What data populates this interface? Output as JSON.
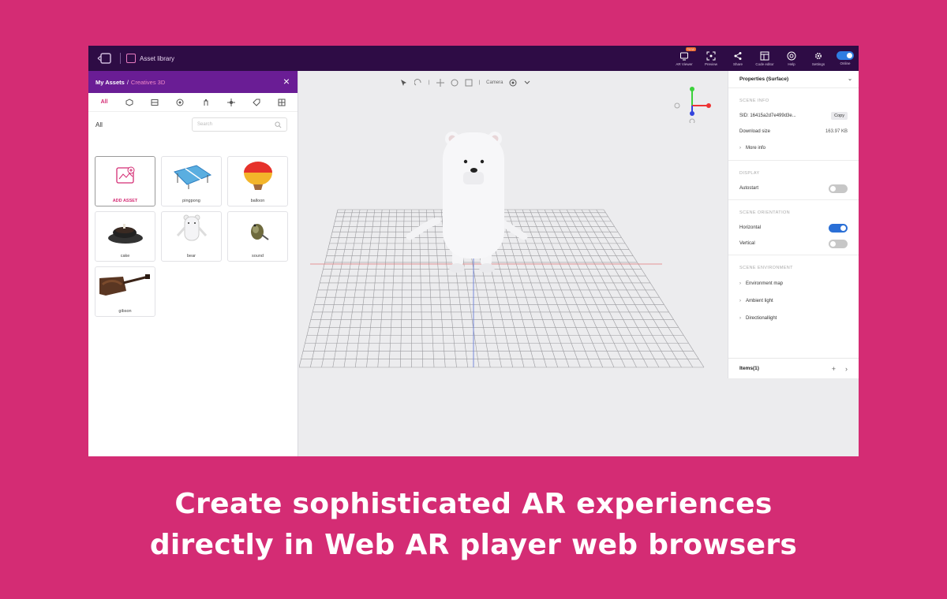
{
  "app": {
    "library_label": "Asset library"
  },
  "toolbar": {
    "tools": [
      {
        "label": "AR Viewer",
        "icon": "ar-viewer-icon",
        "badge": "New"
      },
      {
        "label": "Preview",
        "icon": "preview-icon"
      },
      {
        "label": "Share",
        "icon": "share-icon"
      },
      {
        "label": "Code editor",
        "icon": "code-editor-icon"
      },
      {
        "label": "Help",
        "icon": "help-icon"
      },
      {
        "label": "Settings",
        "icon": "settings-icon"
      },
      {
        "label": "Online",
        "icon": "online-toggle"
      }
    ]
  },
  "left_panel": {
    "breadcrumb_root": "My Assets",
    "breadcrumb_sep": "/",
    "breadcrumb_current": "Creatives 3D",
    "filter_label": "All",
    "search_placeholder": "Search",
    "categories": [
      "All",
      "3d-model-icon",
      "image-icon",
      "target-icon",
      "audio-icon",
      "light-icon",
      "tag-icon",
      "grid-icon"
    ],
    "assets": [
      {
        "name": "ADD ASSET",
        "kind": "add"
      },
      {
        "name": "pingpong",
        "kind": "table"
      },
      {
        "name": "balloon",
        "kind": "balloon"
      },
      {
        "name": "cake",
        "kind": "cake"
      },
      {
        "name": "bear",
        "kind": "bear"
      },
      {
        "name": "sound",
        "kind": "owl"
      },
      {
        "name": "gibson",
        "kind": "guitar"
      }
    ]
  },
  "viewport": {
    "camera_label": "Camera"
  },
  "properties": {
    "title": "Properties (Surface)",
    "scene_info_title": "SCENE INFO",
    "sid": "SID: 16415a2d7e499d3e...",
    "copy_label": "Copy",
    "download_size_label": "Download size",
    "download_size_value": "163.97 KB",
    "more_info_label": "More info",
    "display_title": "DISPLAY",
    "autostart_label": "Autostart",
    "autostart_on": false,
    "orientation_title": "SCENE ORIENTATION",
    "horizontal_label": "Horizontal",
    "horizontal_on": true,
    "vertical_label": "Vertical",
    "vertical_on": false,
    "environment_title": "SCENE ENVIRONMENT",
    "env_items": [
      "Environment map",
      "Ambient light",
      "Directionallight"
    ],
    "footer_label": "Items(1)"
  },
  "caption": {
    "line1": "Create sophisticated AR experiences",
    "line2": "directly in Web AR player web browsers"
  },
  "colors": {
    "background": "#d42c74",
    "topbar": "#2e0c45",
    "panel_header": "#6a1d95",
    "accent": "#d42c74",
    "toggle_on": "#2a6fd6"
  }
}
